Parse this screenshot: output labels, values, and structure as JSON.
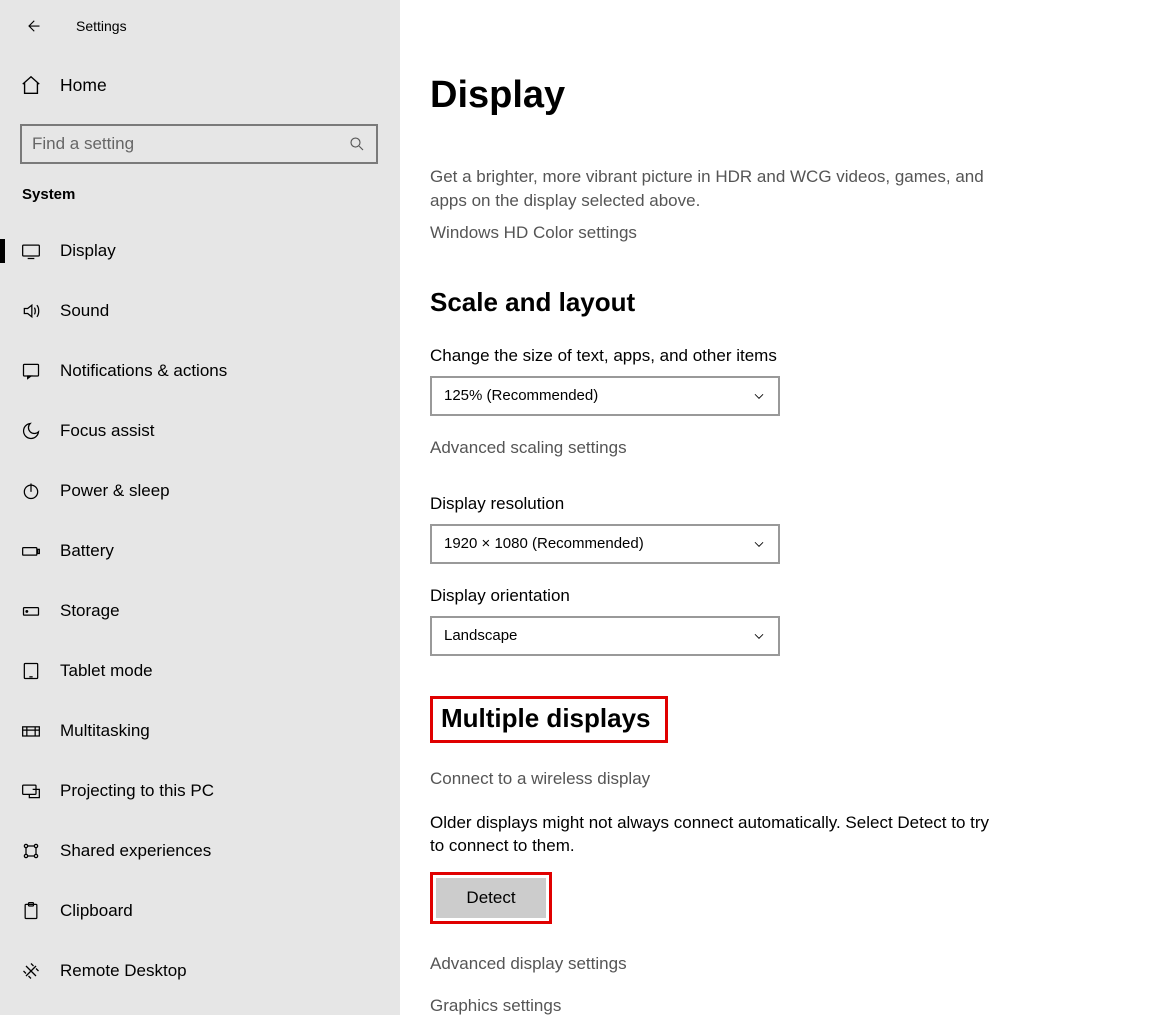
{
  "app_title": "Settings",
  "home_label": "Home",
  "search_placeholder": "Find a setting",
  "category": "System",
  "nav": [
    {
      "label": "Display",
      "active": true
    },
    {
      "label": "Sound"
    },
    {
      "label": "Notifications & actions"
    },
    {
      "label": "Focus assist"
    },
    {
      "label": "Power & sleep"
    },
    {
      "label": "Battery"
    },
    {
      "label": "Storage"
    },
    {
      "label": "Tablet mode"
    },
    {
      "label": "Multitasking"
    },
    {
      "label": "Projecting to this PC"
    },
    {
      "label": "Shared experiences"
    },
    {
      "label": "Clipboard"
    },
    {
      "label": "Remote Desktop"
    }
  ],
  "page": {
    "title": "Display",
    "hdr_text": "Get a brighter, more vibrant picture in HDR and WCG videos, games, and apps on the display selected above.",
    "hdr_link": "Windows HD Color settings",
    "scale_heading": "Scale and layout",
    "scale_label": "Change the size of text, apps, and other items",
    "scale_value": "125% (Recommended)",
    "scale_link": "Advanced scaling settings",
    "resolution_label": "Display resolution",
    "resolution_value": "1920 × 1080 (Recommended)",
    "orientation_label": "Display orientation",
    "orientation_value": "Landscape",
    "multi_heading": "Multiple displays",
    "wireless_link": "Connect to a wireless display",
    "detect_text": "Older displays might not always connect automatically. Select Detect to try to connect to them.",
    "detect_btn": "Detect",
    "adv_display_link": "Advanced display settings",
    "graphics_link": "Graphics settings"
  }
}
